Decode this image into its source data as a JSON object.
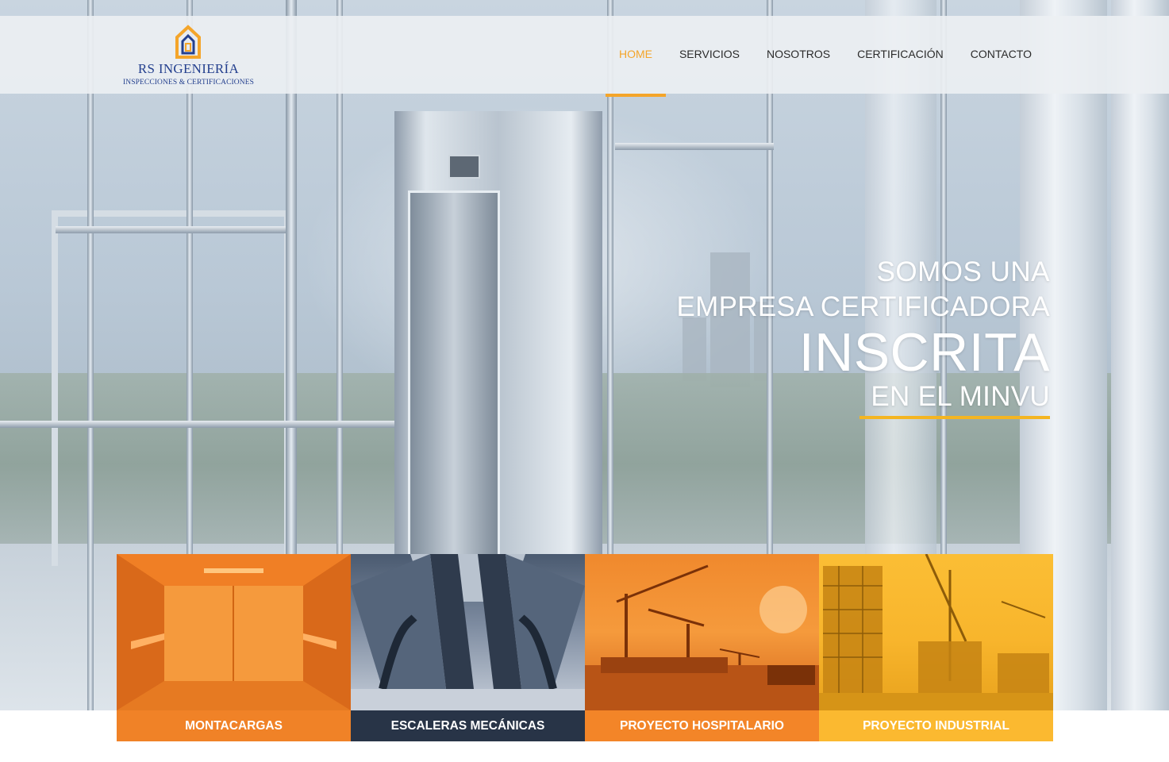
{
  "logo": {
    "name": "RS INGENIERÍA",
    "tagline": "INSPECCIONES & CERTIFICACIONES",
    "icon": "house-icon"
  },
  "nav": {
    "items": [
      {
        "label": "HOME",
        "active": true
      },
      {
        "label": "SERVICIOS",
        "active": false
      },
      {
        "label": "NOSOTROS",
        "active": false
      },
      {
        "label": "CERTIFICACIÓN",
        "active": false
      },
      {
        "label": "CONTACTO",
        "active": false
      }
    ]
  },
  "hero": {
    "line1": "SOMOS UNA",
    "line2": "EMPRESA CERTIFICADORA",
    "line3": "INSCRITA",
    "line4": "EN EL MINVU"
  },
  "cards": [
    {
      "label": "MONTACARGAS"
    },
    {
      "label": "ESCALERAS MECÁNICAS"
    },
    {
      "label": "PROYECTO HOSPITALARIO"
    },
    {
      "label": "PROYECTO INDUSTRIAL"
    }
  ],
  "colors": {
    "accent": "#f4a52a",
    "brand_blue": "#24408e",
    "card_orange": "#f08227",
    "card_navy": "#283447",
    "card_yellow": "#fbb930"
  }
}
